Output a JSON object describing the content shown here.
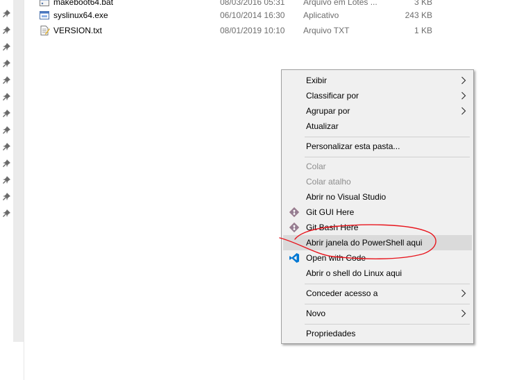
{
  "files": [
    {
      "name": "makeboot64.bat",
      "date": "08/03/2016 05:31",
      "type": "Arquivo em Lotes ...",
      "size": "3 KB",
      "icon": "batch-file-icon"
    },
    {
      "name": "syslinux64.exe",
      "date": "06/10/2014 16:30",
      "type": "Aplicativo",
      "size": "243 KB",
      "icon": "application-icon"
    },
    {
      "name": "VERSION.txt",
      "date": "08/01/2019 10:10",
      "type": "Arquivo TXT",
      "size": "1 KB",
      "icon": "text-file-icon"
    }
  ],
  "context_menu": {
    "items": [
      {
        "label": "Exibir",
        "submenu": true
      },
      {
        "label": "Classificar por",
        "submenu": true
      },
      {
        "label": "Agrupar por",
        "submenu": true
      },
      {
        "label": "Atualizar"
      },
      {
        "label": "Personalizar esta pasta..."
      },
      {
        "label": "Colar",
        "disabled": true
      },
      {
        "label": "Colar atalho",
        "disabled": true
      },
      {
        "label": "Abrir no Visual Studio"
      },
      {
        "label": "Git GUI Here",
        "icon": "git-icon"
      },
      {
        "label": "Git Bash Here",
        "icon": "git-icon"
      },
      {
        "label": "Abrir janela do PowerShell aqui",
        "highlighted": true
      },
      {
        "label": "Open with Code",
        "icon": "vscode-icon"
      },
      {
        "label": "Abrir o shell do Linux aqui"
      },
      {
        "label": "Conceder acesso a",
        "submenu": true
      },
      {
        "label": "Novo",
        "submenu": true
      },
      {
        "label": "Propriedades"
      }
    ]
  },
  "colors": {
    "menu_background": "#f0f0f0",
    "menu_highlight": "#dadada",
    "annotation_red": "#e8141c",
    "git_orange": "#f05033",
    "vscode_blue": "#0078d4"
  }
}
